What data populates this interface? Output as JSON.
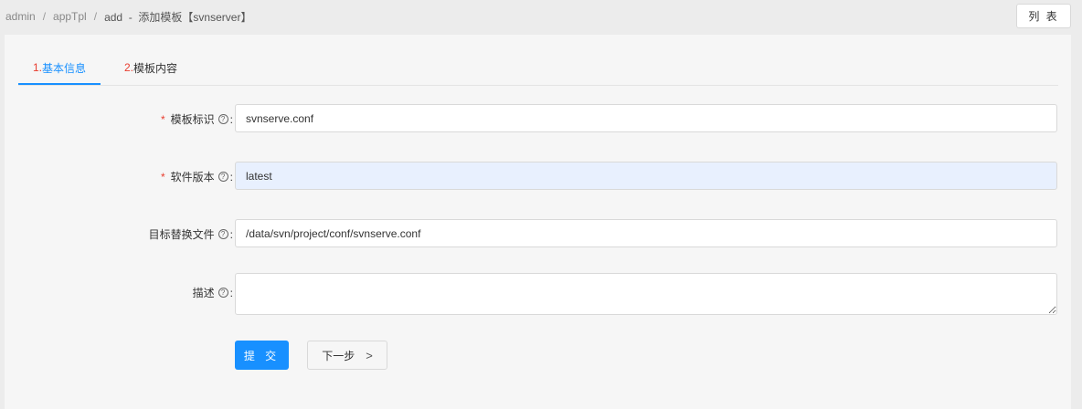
{
  "breadcrumb": {
    "items": [
      "admin",
      "appTpl"
    ],
    "separator": "/",
    "current": "add  -  添加模板【svnserver】"
  },
  "header": {
    "list_button": "列 表"
  },
  "tabs": [
    {
      "num": "1.",
      "label": "基本信息",
      "active": true
    },
    {
      "num": "2.",
      "label": "模板内容",
      "active": false
    }
  ],
  "form": {
    "fields": [
      {
        "label": "模板标识",
        "required": true,
        "value": "svnserve.conf"
      },
      {
        "label": "软件版本",
        "required": true,
        "value": "latest"
      },
      {
        "label": "目标替换文件",
        "required": false,
        "value": "/data/svn/project/conf/svnserve.conf"
      },
      {
        "label": "描述",
        "required": false,
        "value": ""
      }
    ],
    "required_mark": "*",
    "help_mark": "?",
    "colon": ":"
  },
  "actions": {
    "submit_label": "提 交",
    "next_label": "下一步",
    "next_chevron": ">"
  },
  "colors": {
    "primary": "#1890ff",
    "required": "#e83d2f"
  }
}
